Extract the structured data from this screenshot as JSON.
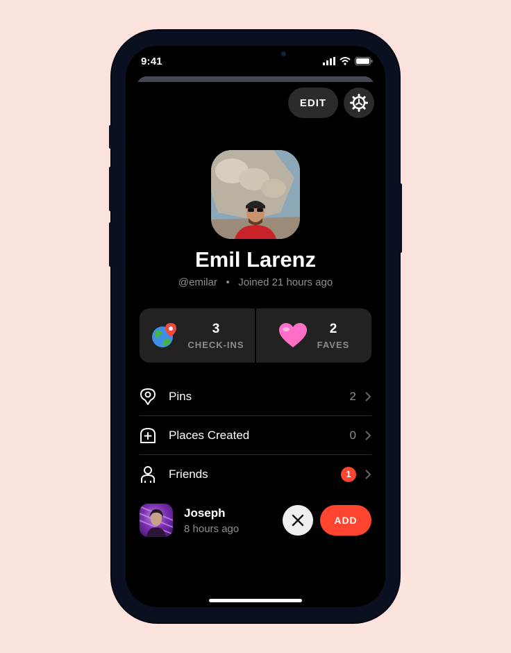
{
  "status_bar": {
    "time": "9:41"
  },
  "header": {
    "edit_label": "EDIT"
  },
  "profile": {
    "name": "Emil Larenz",
    "handle": "@emilar",
    "separator": "•",
    "joined": "Joined 21 hours ago"
  },
  "stats": [
    {
      "value": "3",
      "label": "CHECK-INS",
      "icon": "globe-pin-icon"
    },
    {
      "value": "2",
      "label": "FAVES",
      "icon": "heart-icon"
    }
  ],
  "menu": [
    {
      "label": "Pins",
      "count": "2",
      "icon": "pin-icon"
    },
    {
      "label": "Places Created",
      "count": "0",
      "icon": "add-place-icon"
    },
    {
      "label": "Friends",
      "badge": "1",
      "icon": "person-icon"
    }
  ],
  "friend_request": {
    "name": "Joseph",
    "time": "8 hours ago",
    "add_label": "ADD"
  },
  "colors": {
    "accent": "#ff4530",
    "background": "#fde3de"
  }
}
